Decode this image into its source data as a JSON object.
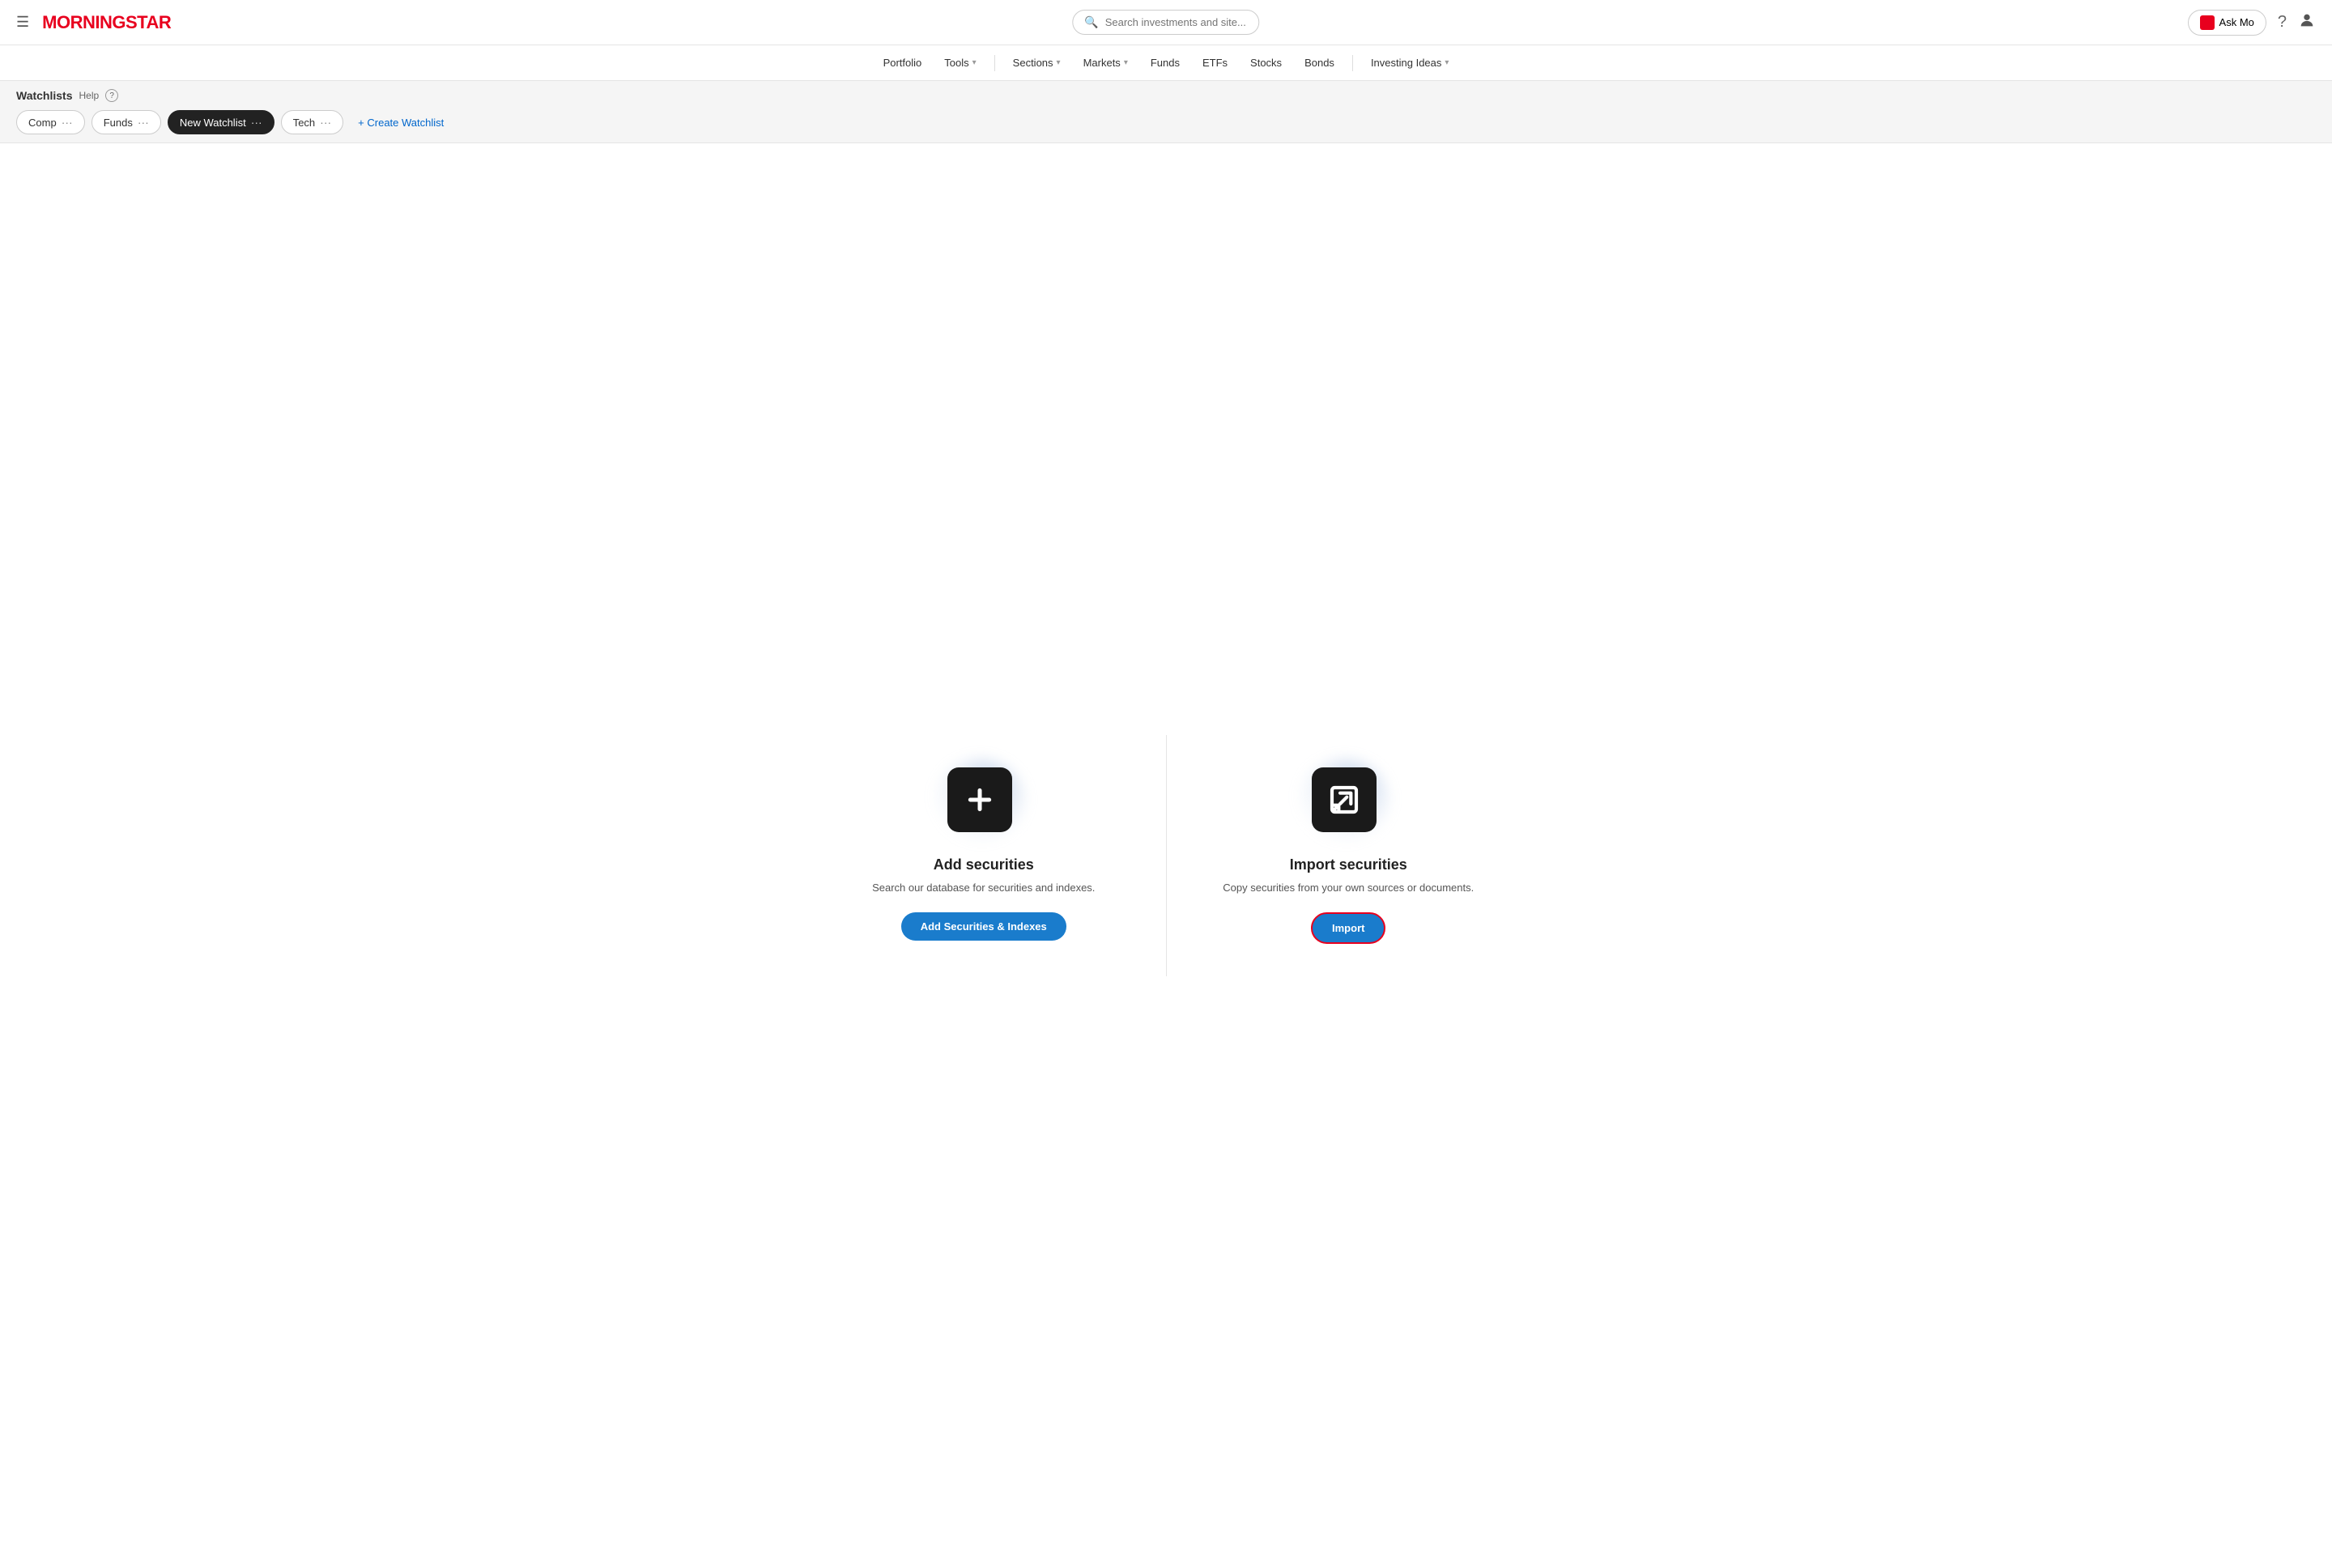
{
  "header": {
    "hamburger_label": "☰",
    "logo": "MORNINGSTAR",
    "search_placeholder": "Search investments and site...",
    "ask_mo_label": "Ask Mo",
    "help_icon": "?",
    "user_icon": "👤"
  },
  "nav": {
    "items": [
      {
        "label": "Portfolio",
        "has_dropdown": false
      },
      {
        "label": "Tools",
        "has_dropdown": true
      },
      {
        "label": "Sections",
        "has_dropdown": true
      },
      {
        "label": "Markets",
        "has_dropdown": true
      },
      {
        "label": "Funds",
        "has_dropdown": false
      },
      {
        "label": "ETFs",
        "has_dropdown": false
      },
      {
        "label": "Stocks",
        "has_dropdown": false
      },
      {
        "label": "Bonds",
        "has_dropdown": false
      },
      {
        "label": "Investing Ideas",
        "has_dropdown": true
      }
    ]
  },
  "watchlists": {
    "title": "Watchlists",
    "help_label": "Help",
    "tabs": [
      {
        "label": "Comp",
        "active": false
      },
      {
        "label": "Funds",
        "active": false
      },
      {
        "label": "New Watchlist",
        "active": true
      },
      {
        "label": "Tech",
        "active": false
      }
    ],
    "create_label": "+ Create Watchlist"
  },
  "main": {
    "add_section": {
      "icon_type": "plus",
      "title": "Add securities",
      "description": "Search our database for securities and indexes.",
      "button_label": "Add Securities & Indexes"
    },
    "import_section": {
      "icon_type": "import",
      "title": "Import securities",
      "description": "Copy securities from your own sources or documents.",
      "button_label": "Import"
    }
  }
}
